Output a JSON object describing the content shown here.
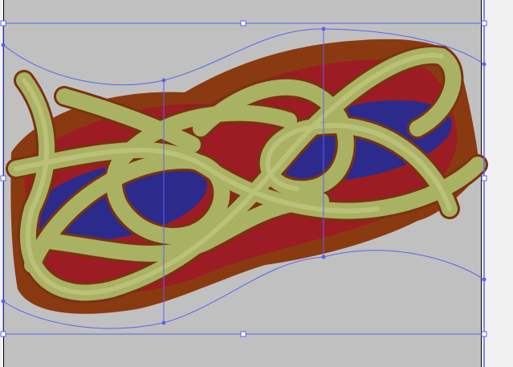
{
  "colors": {
    "canvas": "#c0c0c0",
    "outside": "#f0f0f0",
    "outline": "#8a3a10",
    "cord": "#a9b163",
    "cord_light": "#c8cd86",
    "red_fill": "#9b1c22",
    "blue_fill": "#2c2b8c",
    "envelope": "#5a62f0"
  },
  "icons": {
    "handle": "envelope-handle-icon"
  }
}
